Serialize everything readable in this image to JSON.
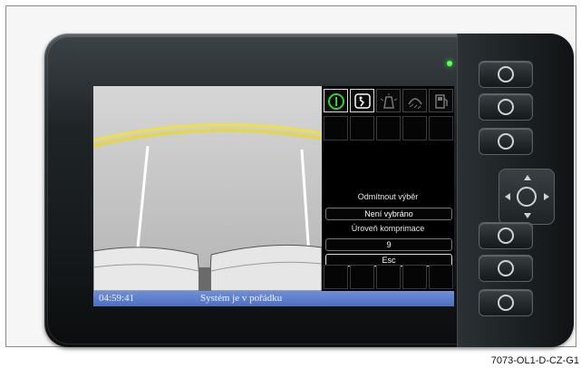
{
  "figure_code": "7073-OL1-D-CZ-G1",
  "screen": {
    "panel": {
      "icons": [
        "power-info-icon",
        "seat-person-icon",
        "exterior-lights-icon",
        "fog-light-icon",
        "fuel-pump-icon"
      ],
      "menu_label_1": "Odmítnout výběr",
      "menu_value_1": "Není vybráno",
      "menu_label_2": "Úroveň komprimace",
      "menu_value_2": "9",
      "esc_label": "Esc"
    },
    "status": {
      "time": "04:59:41",
      "message": "Systém je v pořádku"
    }
  },
  "colors": {
    "active_icon": "#35d035",
    "status_bar": "#5a7cc8",
    "led": "#5dff5d",
    "guide_line": "#f0e040"
  }
}
